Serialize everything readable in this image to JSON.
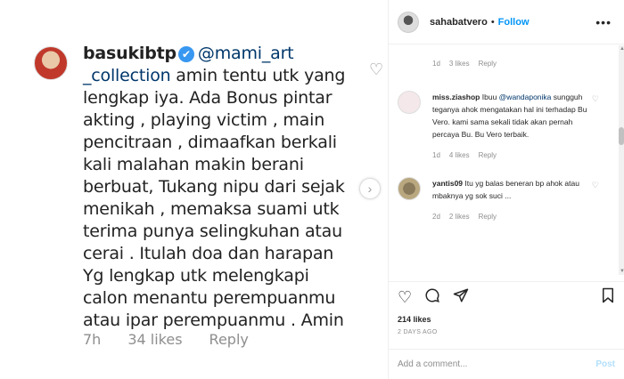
{
  "post_image": {
    "username": "basukibtp",
    "verified_glyph": "✔",
    "mention": "@mami_art _collection",
    "comment_text": " amin tentu utk yang lengkap iya. Ada Bonus pintar akting , playing  victim , main pencitraan , dimaafkan berkali kali malahan makin berani berbuat, Tukang nipu dari sejak menikah , memaksa suami utk terima punya selingkuhan atau cerai . Itulah doa dan harapan Yg lengkap utk melengkapi calon menantu perempuanmu atau ipar perempuanmu . Amin",
    "time": "7h",
    "likes": "34 likes",
    "reply": "Reply"
  },
  "header": {
    "username": "sahabatvero",
    "separator": "•",
    "follow_label": "Follow",
    "more_icon": "•••"
  },
  "comments": [
    {
      "meta_time": "1d",
      "meta_likes": "3 likes",
      "meta_reply": "Reply"
    },
    {
      "username": "miss.ziashop",
      "text_before": " Ibuu ",
      "mention": "@wandaponika",
      "text_after": " sungguh teganya ahok mengatakan hal ini terhadap Bu Vero. kami sama sekali tidak akan pernah percaya Bu. Bu Vero terbaik.",
      "time": "1d",
      "likes": "4 likes",
      "reply": "Reply"
    },
    {
      "username": "yantis09",
      "text": " Itu yg balas beneran bp ahok atau mbaknya yg sok suci ...",
      "time": "2d",
      "likes": "2 likes",
      "reply": "Reply"
    }
  ],
  "actions": {
    "like_count": "214 likes",
    "date": "2 DAYS AGO",
    "comment_placeholder": "Add a comment...",
    "post_label": "Post"
  },
  "colors": {
    "accent": "#0095f6",
    "verified": "#3897f0",
    "mention": "#00376b",
    "muted": "#8e8e8e"
  }
}
